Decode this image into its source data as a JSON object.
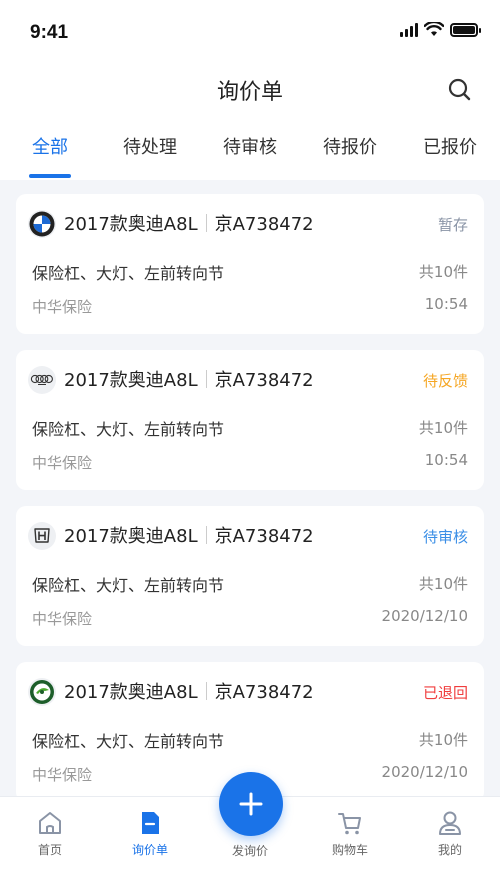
{
  "status_bar": {
    "time": "9:41"
  },
  "nav": {
    "title": "询价单"
  },
  "tabs": [
    {
      "label": "全部",
      "active": true
    },
    {
      "label": "待处理",
      "active": false
    },
    {
      "label": "待审核",
      "active": false
    },
    {
      "label": "待报价",
      "active": false
    },
    {
      "label": "已报价",
      "active": false
    }
  ],
  "cards": [
    {
      "brand": "bmw",
      "model": "2017款奥迪A8L",
      "plate": "京A738472",
      "status": "暂存",
      "status_color": "#8a94a6",
      "parts": "保险杠、大灯、左前转向节",
      "count": "共10件",
      "company": "中华保险",
      "time": "10:54"
    },
    {
      "brand": "audi",
      "model": "2017款奥迪A8L",
      "plate": "京A738472",
      "status": "待反馈",
      "status_color": "#f5a623",
      "parts": "保险杠、大灯、左前转向节",
      "count": "共10件",
      "company": "中华保险",
      "time": "10:54"
    },
    {
      "brand": "honda",
      "model": "2017款奥迪A8L",
      "plate": "京A738472",
      "status": "待审核",
      "status_color": "#3a8ee6",
      "parts": "保险杠、大灯、左前转向节",
      "count": "共10件",
      "company": "中华保险",
      "time": "2020/12/10"
    },
    {
      "brand": "skoda",
      "model": "2017款奥迪A8L",
      "plate": "京A738472",
      "status": "已退回",
      "status_color": "#f03d3d",
      "parts": "保险杠、大灯、左前转向节",
      "count": "共10件",
      "company": "中华保险",
      "time": "2020/12/10"
    }
  ],
  "tab_bar": {
    "home": "首页",
    "inquiry": "询价单",
    "new_inquiry": "发询价",
    "cart": "购物车",
    "mine": "我的"
  },
  "colors": {
    "accent": "#1a73e8"
  }
}
